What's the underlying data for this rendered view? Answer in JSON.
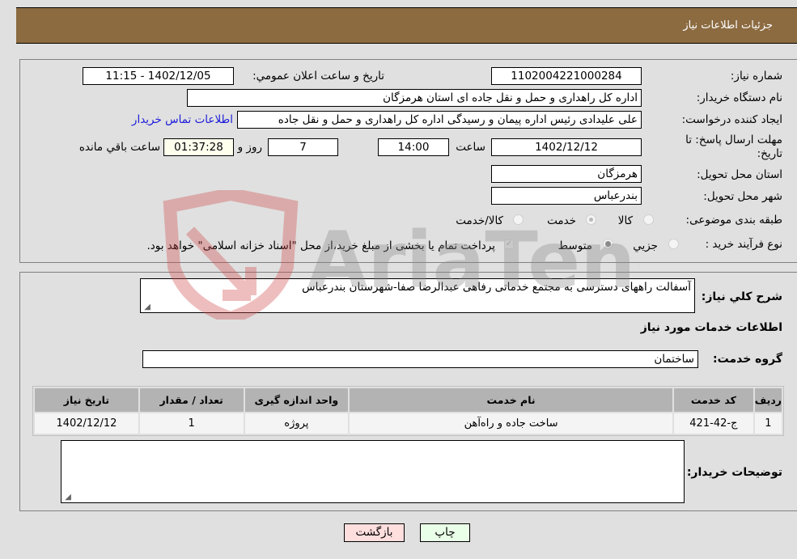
{
  "header": {
    "title": "جزئیات اطلاعات نیاز"
  },
  "details": {
    "need_number_label": "شماره نیاز:",
    "need_number": "1102004221000284",
    "announce_label": "تاريخ و ساعت اعلان عمومي:",
    "announce_value": "1402/12/05 - 11:15",
    "buyer_org_label": "نام دستگاه خريدار:",
    "buyer_org": "اداره کل راهداری و حمل و نقل جاده ای استان هرمزگان",
    "creator_label": "ايجاد کننده درخواست:",
    "creator": "علی علیدادی رئیس اداره پیمان و رسیدگی اداره کل راهداری و حمل و نقل جاده",
    "contact_link": "اطلاعات تماس خريدار",
    "deadline_label": "مهلت ارسال پاسخ: تا تاريخ:",
    "deadline_date": "1402/12/12",
    "time_label": "ساعت",
    "deadline_time": "14:00",
    "days": "7",
    "days_label": "روز و",
    "remaining_time": "01:37:28",
    "remaining_label": "ساعت باقي مانده",
    "province_label": "استان محل تحويل:",
    "province": "هرمزگان",
    "city_label": "شهر محل تحويل:",
    "city": "بندرعباس",
    "category_label": "طبقه بندی موضوعی:",
    "category_options": [
      "کالا",
      "خدمت",
      "کالا/خدمت"
    ],
    "category_selected": "خدمت",
    "process_label": "نوع فرآيند خريد :",
    "process_options": [
      "جزيي",
      "متوسط"
    ],
    "process_selected": "متوسط",
    "treasury_note": "پرداخت تمام يا بخشی از مبلغ خريد،از محل \"اسناد خزانه اسلامی\" خواهد بود."
  },
  "description": {
    "label": "شرح كلي نياز:",
    "value": "آسفالت راههای دسترسی به مجتمع خدماتی رفاهی عبدالرضا صفا-شهرستان بندرعباس"
  },
  "services": {
    "section_title": "اطلاعات خدمات مورد نياز",
    "group_label": "گروه خدمت:",
    "group_value": "ساختمان",
    "columns": [
      "رديف",
      "كد خدمت",
      "نام خدمت",
      "واحد اندازه گيری",
      "تعداد / مقدار",
      "تاريخ نياز"
    ],
    "rows": [
      [
        "1",
        "ج-42-421",
        "ساخت جاده و راه‌آهن",
        "پروژه",
        "1",
        "1402/12/12"
      ]
    ]
  },
  "buyer_notes": {
    "label": "توضيحات خريدار:",
    "value": ""
  },
  "buttons": {
    "back": "بازگشت",
    "print": "چاپ"
  },
  "watermark": {
    "text": "AriaTender.neT"
  }
}
